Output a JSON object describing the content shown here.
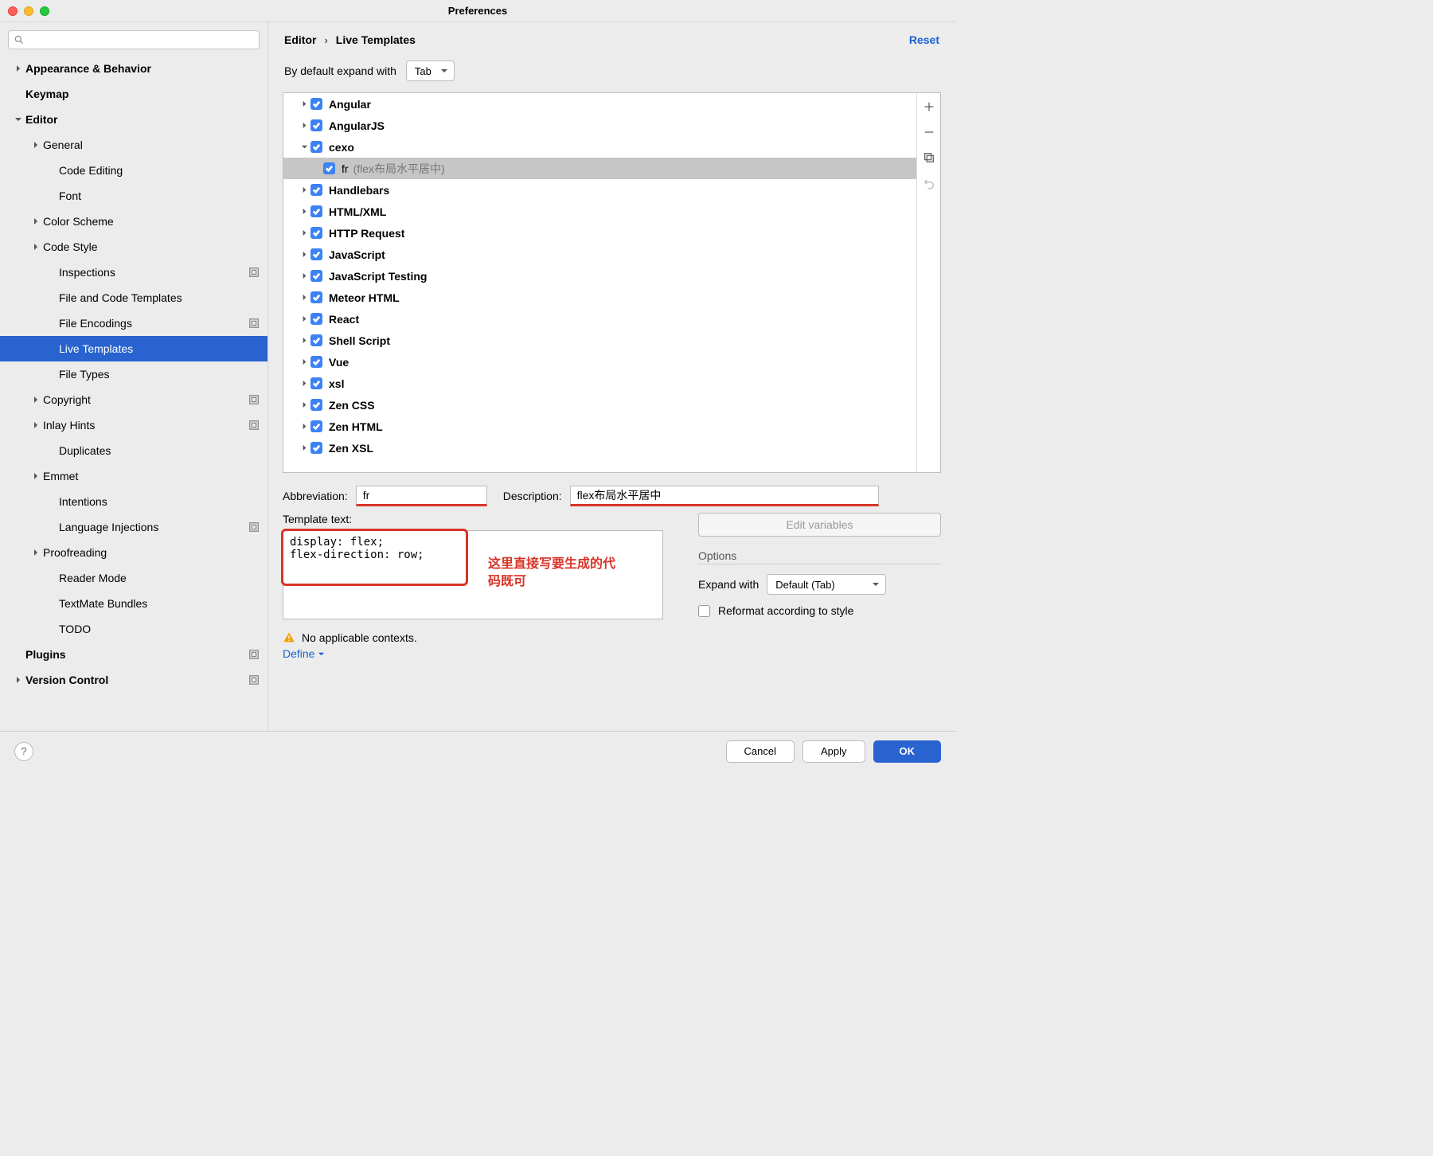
{
  "window": {
    "title": "Preferences"
  },
  "breadcrumb": {
    "a": "Editor",
    "b": "Live Templates",
    "reset": "Reset"
  },
  "expand": {
    "label": "By default expand with",
    "value": "Tab"
  },
  "sidebar": {
    "items": [
      {
        "label": "Appearance & Behavior",
        "depth": 0,
        "bold": true,
        "chev": "right"
      },
      {
        "label": "Keymap",
        "depth": 0,
        "bold": true
      },
      {
        "label": "Editor",
        "depth": 0,
        "bold": true,
        "chev": "down"
      },
      {
        "label": "General",
        "depth": 1,
        "chev": "right"
      },
      {
        "label": "Code Editing",
        "depth": 2
      },
      {
        "label": "Font",
        "depth": 2
      },
      {
        "label": "Color Scheme",
        "depth": 1,
        "chev": "right"
      },
      {
        "label": "Code Style",
        "depth": 1,
        "chev": "right"
      },
      {
        "label": "Inspections",
        "depth": 2,
        "badge": true
      },
      {
        "label": "File and Code Templates",
        "depth": 2
      },
      {
        "label": "File Encodings",
        "depth": 2,
        "badge": true
      },
      {
        "label": "Live Templates",
        "depth": 2,
        "selected": true
      },
      {
        "label": "File Types",
        "depth": 2
      },
      {
        "label": "Copyright",
        "depth": 1,
        "chev": "right",
        "badge": true
      },
      {
        "label": "Inlay Hints",
        "depth": 1,
        "chev": "right",
        "badge": true
      },
      {
        "label": "Duplicates",
        "depth": 2
      },
      {
        "label": "Emmet",
        "depth": 1,
        "chev": "right"
      },
      {
        "label": "Intentions",
        "depth": 2
      },
      {
        "label": "Language Injections",
        "depth": 2,
        "badge": true
      },
      {
        "label": "Proofreading",
        "depth": 1,
        "chev": "right"
      },
      {
        "label": "Reader Mode",
        "depth": 2
      },
      {
        "label": "TextMate Bundles",
        "depth": 2
      },
      {
        "label": "TODO",
        "depth": 2
      },
      {
        "label": "Plugins",
        "depth": 0,
        "bold": true,
        "badge": true
      },
      {
        "label": "Version Control",
        "depth": 0,
        "bold": true,
        "chev": "right",
        "badge": true
      }
    ]
  },
  "templates": {
    "groups": [
      {
        "label": "Angular",
        "chev": "right"
      },
      {
        "label": "AngularJS",
        "chev": "right"
      },
      {
        "label": "cexo",
        "chev": "down",
        "children": [
          {
            "abbr": "fr",
            "desc": "(flex布局水平居中)"
          }
        ]
      },
      {
        "label": "Handlebars",
        "chev": "right"
      },
      {
        "label": "HTML/XML",
        "chev": "right"
      },
      {
        "label": "HTTP Request",
        "chev": "right"
      },
      {
        "label": "JavaScript",
        "chev": "right"
      },
      {
        "label": "JavaScript Testing",
        "chev": "right"
      },
      {
        "label": "Meteor HTML",
        "chev": "right"
      },
      {
        "label": "React",
        "chev": "right"
      },
      {
        "label": "Shell Script",
        "chev": "right"
      },
      {
        "label": "Vue",
        "chev": "right"
      },
      {
        "label": "xsl",
        "chev": "right"
      },
      {
        "label": "Zen CSS",
        "chev": "right"
      },
      {
        "label": "Zen HTML",
        "chev": "right"
      },
      {
        "label": "Zen XSL",
        "chev": "right"
      }
    ]
  },
  "form": {
    "abbrev_label": "Abbreviation:",
    "abbrev_value": "fr",
    "desc_label": "Description:",
    "desc_value": "flex布局水平居中",
    "template_label": "Template text:",
    "template_value": "display: flex;\nflex-direction: row;",
    "edit_vars": "Edit variables",
    "options_title": "Options",
    "expand_with_label": "Expand with",
    "expand_with_value": "Default (Tab)",
    "reformat_label": "Reformat according to style",
    "no_context": "No applicable contexts.",
    "define": "Define"
  },
  "annotation": {
    "line1": "这里直接写要生成的代",
    "line2": "码既可"
  },
  "footer": {
    "cancel": "Cancel",
    "apply": "Apply",
    "ok": "OK"
  }
}
